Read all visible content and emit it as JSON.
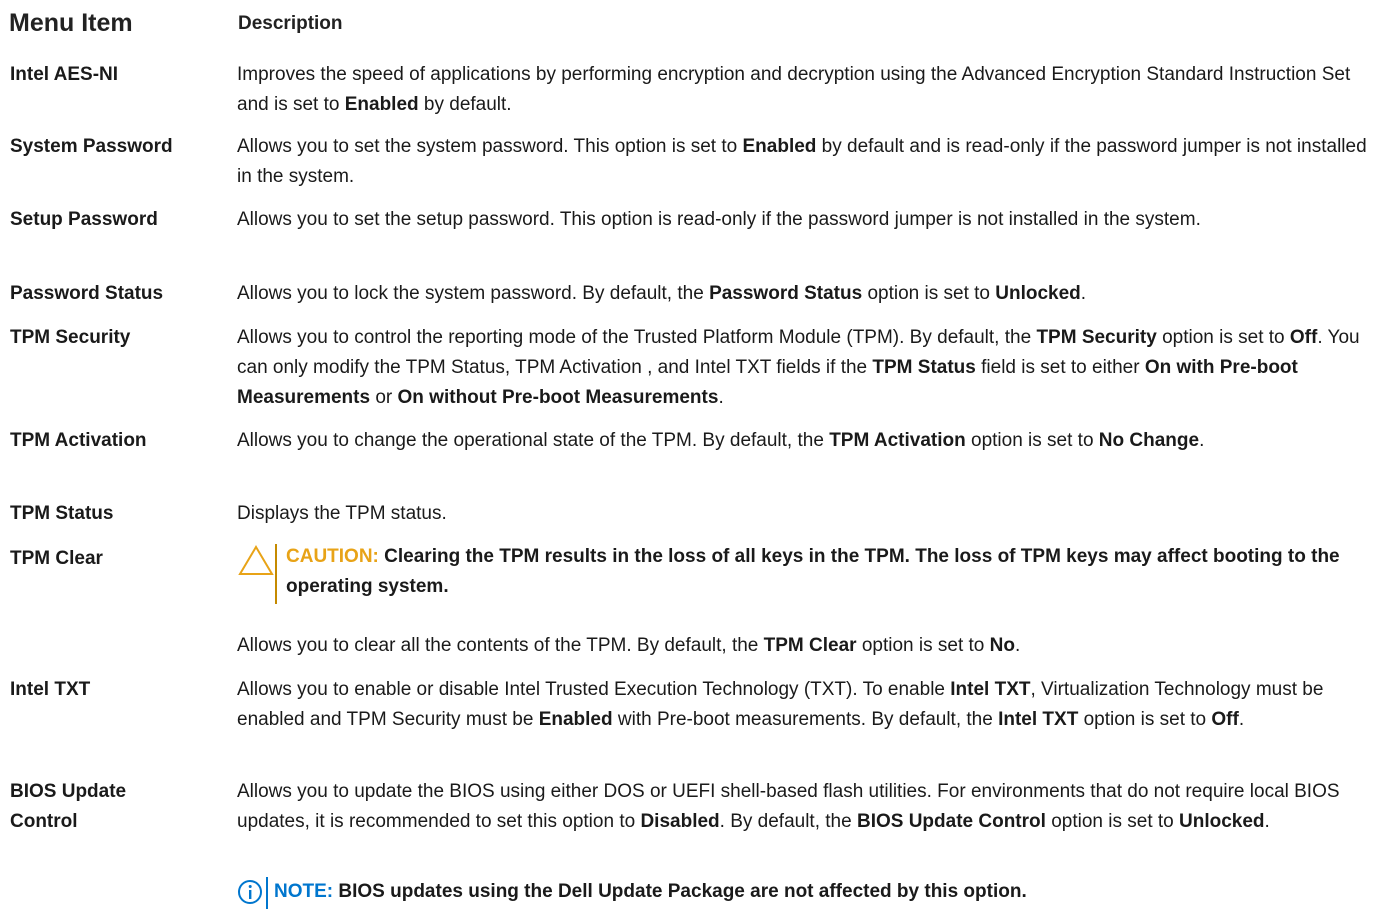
{
  "headers": {
    "menu_item": "Menu Item",
    "description": "Description"
  },
  "rows": [
    {
      "term": "Intel AES-NI",
      "desc": [
        "Improves the speed of applications by performing encryption and decryption using the Advanced Encryption Standard Instruction Set and is set to ",
        "Enabled",
        " by default."
      ]
    },
    {
      "term": "System Password",
      "desc": [
        "Allows you to set the system password. This option is set to ",
        "Enabled",
        " by default and is read-only if the password jumper is not installed in the system."
      ]
    },
    {
      "term": "Setup Password",
      "desc": [
        "Allows you to set the setup password. This option is read-only if the password jumper is not installed in the system."
      ]
    },
    {
      "term": "Password Status",
      "desc": [
        "Allows you to lock the system password. By default, the ",
        "Password Status",
        " option is set to ",
        "Unlocked",
        "."
      ]
    },
    {
      "term": "TPM Security",
      "desc": [
        "Allows you to control the reporting mode of the Trusted Platform Module (TPM). By default, the ",
        "TPM Security",
        " option is set to ",
        "Off",
        ". You can only modify the TPM Status, TPM Activation , and Intel TXT fields if the ",
        "TPM Status",
        " field is set to either ",
        "On with Pre-boot Measurements",
        " or ",
        "On without Pre-boot Measurements",
        "."
      ]
    },
    {
      "term": "TPM Activation",
      "desc": [
        "Allows you to change the operational state of the TPM. By default, the ",
        "TPM Activation",
        " option is set to ",
        "No Change",
        "."
      ]
    },
    {
      "term": "TPM Status",
      "desc": [
        "Displays the TPM status."
      ]
    },
    {
      "term": "TPM Clear",
      "caution": {
        "label": "CAUTION:",
        "text": " Clearing the TPM results in the loss of all keys in the TPM. The loss of TPM keys may affect booting to the operating system."
      },
      "desc": [
        "Allows you to clear all the contents of the TPM. By default, the ",
        "TPM Clear",
        " option is set to ",
        "No",
        "."
      ]
    },
    {
      "term": "Intel TXT",
      "desc": [
        "Allows you to enable or disable Intel Trusted Execution Technology (TXT). To enable ",
        "Intel TXT",
        ", Virtualization Technology must be enabled and TPM Security must be ",
        "Enabled",
        " with Pre-boot measurements. By default, the ",
        "Intel TXT",
        " option is set to ",
        "Off",
        "."
      ]
    },
    {
      "term": "BIOS Update Control",
      "desc": [
        "Allows you to update the BIOS using either DOS or UEFI shell-based flash utilities. For environments that do not require local BIOS updates, it is recommended to set this option to ",
        "Disabled",
        ". By default, the ",
        "BIOS Update Control",
        " option is set to ",
        "Unlocked",
        "."
      ],
      "note": {
        "label": "NOTE:",
        "text": " BIOS updates using the Dell Update Package are not affected by this option."
      }
    }
  ],
  "colors": {
    "caution": "#e8a317",
    "note": "#0076ce",
    "text": "#1a1a1a"
  },
  "icons": {
    "caution": "warning-triangle-icon",
    "note": "info-circle-icon"
  }
}
